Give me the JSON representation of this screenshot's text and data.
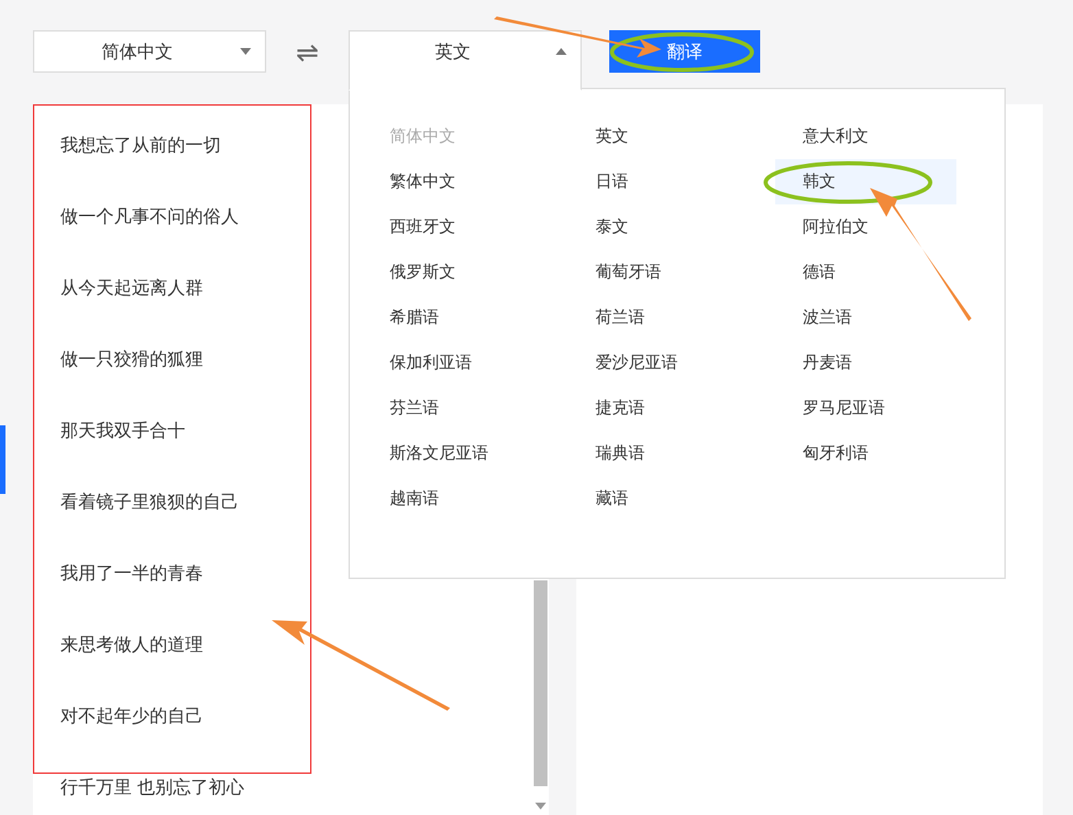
{
  "source_language": {
    "value": "简体中文",
    "expanded": false
  },
  "swap_icon": "⇌",
  "target_language": {
    "value": "英文",
    "expanded": true
  },
  "translate_button": "翻译",
  "language_options": [
    {
      "label": "简体中文",
      "disabled": true,
      "selected": false
    },
    {
      "label": "英文",
      "disabled": false,
      "selected": false
    },
    {
      "label": "意大利文",
      "disabled": false,
      "selected": false
    },
    {
      "label": "繁体中文",
      "disabled": false,
      "selected": false
    },
    {
      "label": "日语",
      "disabled": false,
      "selected": false
    },
    {
      "label": "韩文",
      "disabled": false,
      "selected": true
    },
    {
      "label": "西班牙文",
      "disabled": false,
      "selected": false
    },
    {
      "label": "泰文",
      "disabled": false,
      "selected": false
    },
    {
      "label": "阿拉伯文",
      "disabled": false,
      "selected": false
    },
    {
      "label": "俄罗斯文",
      "disabled": false,
      "selected": false
    },
    {
      "label": "葡萄牙语",
      "disabled": false,
      "selected": false
    },
    {
      "label": "德语",
      "disabled": false,
      "selected": false
    },
    {
      "label": "希腊语",
      "disabled": false,
      "selected": false
    },
    {
      "label": "荷兰语",
      "disabled": false,
      "selected": false
    },
    {
      "label": "波兰语",
      "disabled": false,
      "selected": false
    },
    {
      "label": "保加利亚语",
      "disabled": false,
      "selected": false
    },
    {
      "label": "爱沙尼亚语",
      "disabled": false,
      "selected": false
    },
    {
      "label": "丹麦语",
      "disabled": false,
      "selected": false
    },
    {
      "label": "芬兰语",
      "disabled": false,
      "selected": false
    },
    {
      "label": "捷克语",
      "disabled": false,
      "selected": false
    },
    {
      "label": "罗马尼亚语",
      "disabled": false,
      "selected": false
    },
    {
      "label": "斯洛文尼亚语",
      "disabled": false,
      "selected": false
    },
    {
      "label": "瑞典语",
      "disabled": false,
      "selected": false
    },
    {
      "label": "匈牙利语",
      "disabled": false,
      "selected": false
    },
    {
      "label": "越南语",
      "disabled": false,
      "selected": false
    },
    {
      "label": "藏语",
      "disabled": false,
      "selected": false
    }
  ],
  "source_text_lines": [
    "我想忘了从前的一切",
    "做一个凡事不问的俗人",
    "从今天起远离人群",
    "做一只狡猾的狐狸",
    "那天我双手合十",
    "看着镜子里狼狈的自己",
    "我用了一半的青春",
    "来思考做人的道理",
    "对不起年少的自己",
    "行千万里 也别忘了初心"
  ]
}
